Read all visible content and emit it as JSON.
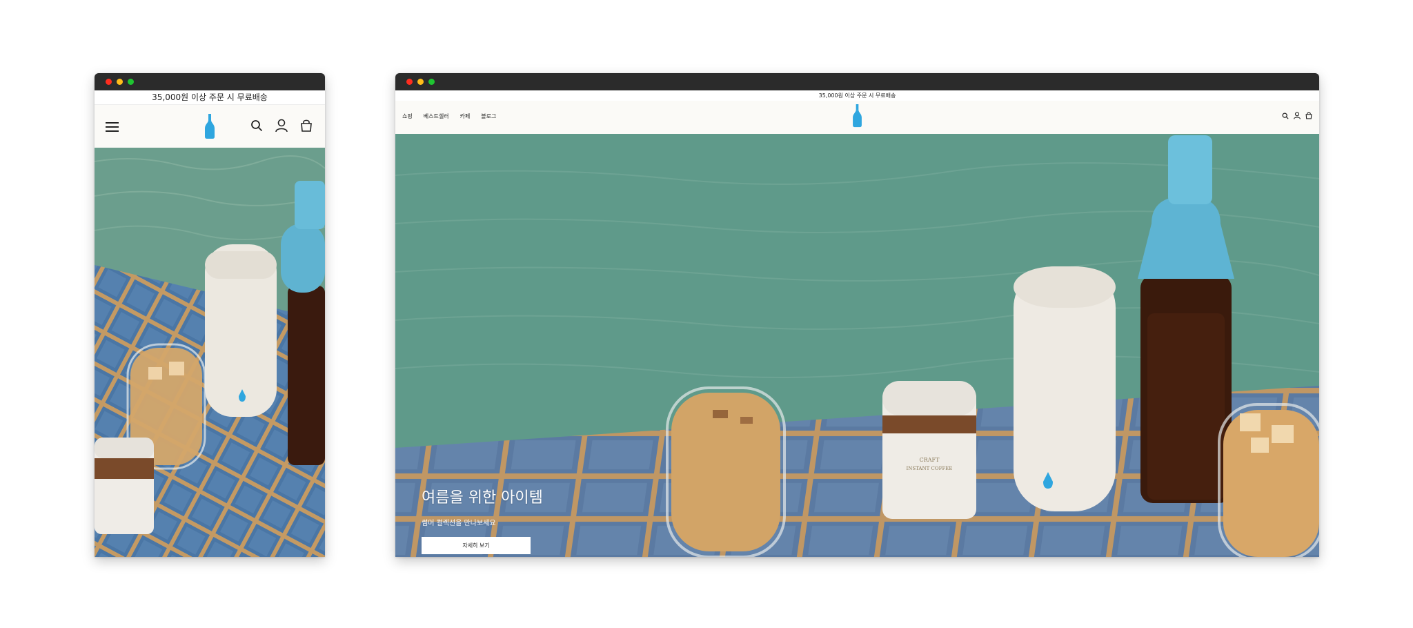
{
  "announcement": "35,000원 이상 주문 시 무료배송",
  "nav": {
    "menu": [
      "쇼핑",
      "베스트셀러",
      "카페",
      "블로그"
    ]
  },
  "icons": {
    "menu": "hamburger-icon",
    "logo": "blue-bottle-logo",
    "search": "search-icon",
    "account": "account-icon",
    "cart": "shopping-bag-icon"
  },
  "hero": {
    "title": "여름을 위한 아이템",
    "subtitle": "썸머 컬렉션을 만나보세요",
    "cta": "자세히 보기"
  },
  "colors": {
    "brand_blue": "#2fa6df",
    "titlebar": "#2b2b2b",
    "pool_water": "#5f9a8a",
    "tile_blue": "#4f7aa3"
  }
}
